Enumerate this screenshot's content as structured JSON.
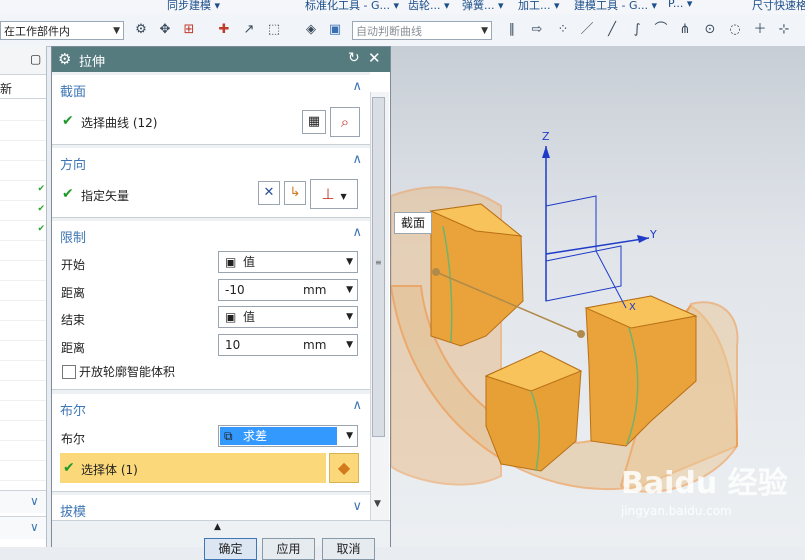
{
  "ribbon": {
    "items": [
      "同步建模 ▾",
      "标准化工具 - G... ▾",
      "齿轮... ▾",
      "弹簧... ▾",
      "加工... ▾",
      "建模工具 - G... ▾",
      "P... ▾",
      "尺寸快速格"
    ]
  },
  "toolbar": {
    "scope_combo": "在工作部件内",
    "curve_rule_placeholder": "自动判断曲线"
  },
  "left_panel": {
    "header_suffix": "新"
  },
  "dialog": {
    "title": "拉伸",
    "sections": {
      "section": {
        "title": "截面",
        "select_curve_label": "选择曲线 (12)"
      },
      "direction": {
        "title": "方向",
        "vector_label": "指定矢量"
      },
      "limits": {
        "title": "限制",
        "start_label": "开始",
        "start_option": "值",
        "start_distance_label": "距离",
        "start_distance": "-10",
        "start_unit": "mm",
        "end_label": "结束",
        "end_option": "值",
        "end_distance_label": "距离",
        "end_distance": "10",
        "end_unit": "mm",
        "open_profile_label": "开放轮廓智能体积"
      },
      "boolean": {
        "title": "布尔",
        "boolean_label": "布尔",
        "boolean_option": "求差",
        "select_body_label": "选择体 (1)"
      },
      "draft": {
        "title": "拔模"
      }
    },
    "footer": {
      "ok": "确定",
      "apply": "应用",
      "cancel": "取消"
    }
  },
  "viewport": {
    "tooltip": "截面",
    "axis_z": "Z",
    "axis_y": "Y",
    "axis_x": "X",
    "watermark": "Baidu 经验",
    "watermark_url": "jingyan.baidu.com"
  },
  "colors": {
    "title_bar": "#567b7e",
    "section_header": "#3e77b4",
    "check_green": "#1f9a2a",
    "selected_row": "#fbd97a",
    "solid_orange": "#e9a33a"
  }
}
